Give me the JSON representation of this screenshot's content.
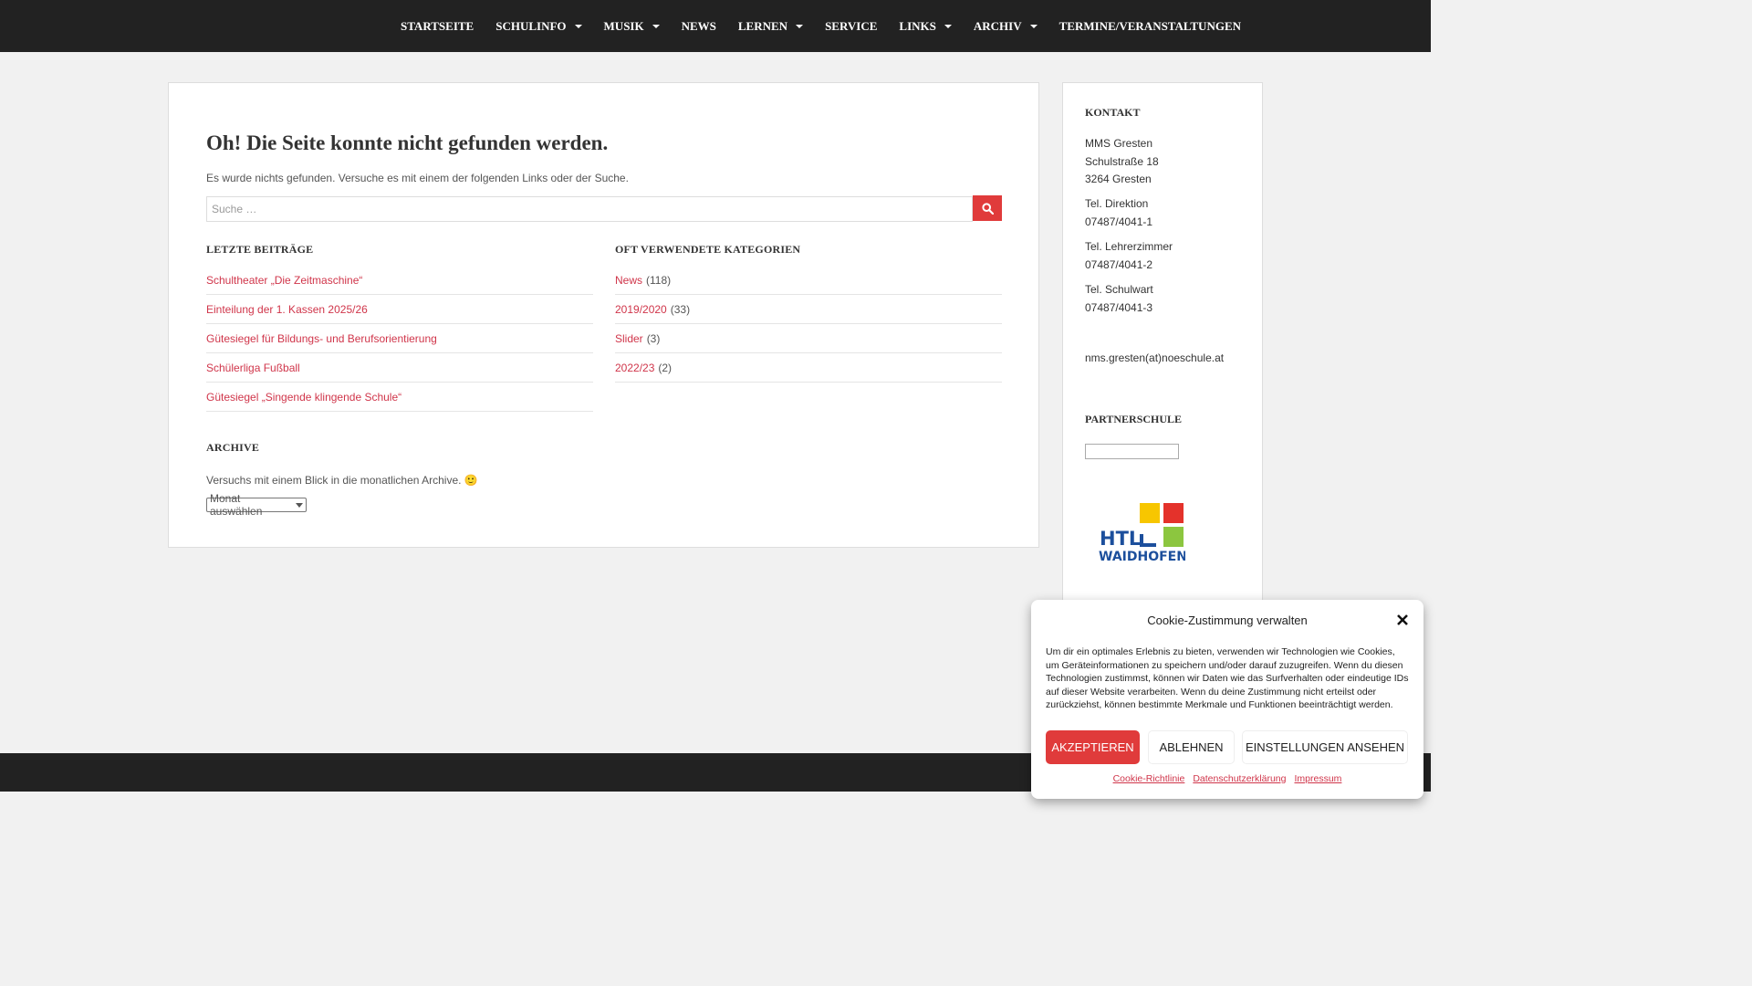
{
  "nav": {
    "items": [
      {
        "label": "STARTSEITE",
        "has_dropdown": false
      },
      {
        "label": "SCHULINFO",
        "has_dropdown": true
      },
      {
        "label": "MUSIK",
        "has_dropdown": true
      },
      {
        "label": "NEWS",
        "has_dropdown": false
      },
      {
        "label": "LERNEN",
        "has_dropdown": true
      },
      {
        "label": "SERVICE",
        "has_dropdown": false
      },
      {
        "label": "LINKS",
        "has_dropdown": true
      },
      {
        "label": "ARCHIV",
        "has_dropdown": true
      },
      {
        "label": "TERMINE/VERANSTALTUNGEN",
        "has_dropdown": false
      }
    ]
  },
  "main": {
    "title": "Oh! Die Seite konnte nicht gefunden werden.",
    "intro": "Es wurde nichts gefunden. Versuche es mit einem der folgenden Links oder der Suche.",
    "search": {
      "placeholder": "Suche …",
      "button_icon": "search-icon"
    },
    "recent_posts": {
      "title": "LETZTE BEITRÄGE",
      "items": [
        "Schultheater „Die Zeitmaschine“",
        "Einteilung der 1. Kassen 2025/26",
        "Gütesiegel für Bildungs- und Berufsorientierung",
        "Schülerliga Fußball",
        "Gütesiegel „Singende klingende Schule“"
      ]
    },
    "categories": {
      "title": "OFT VERWENDETE KATEGORIEN",
      "items": [
        {
          "name": "News",
          "count": "(118)"
        },
        {
          "name": "2019/2020",
          "count": "(33)"
        },
        {
          "name": "Slider",
          "count": "(3)"
        },
        {
          "name": "2022/23",
          "count": "(2)"
        }
      ]
    },
    "archive": {
      "title": "ARCHIVE",
      "text": "Versuchs mit einem Blick in die monatlichen Archive. 🙂",
      "select_value": "Monat auswählen"
    }
  },
  "sidebar": {
    "contact_title": "KONTAKT",
    "address": [
      "MMS Gresten",
      "Schulstraße 18",
      "3264 Gresten"
    ],
    "phones": [
      {
        "label": "Tel. Direktion",
        "number": "07487/4041-1"
      },
      {
        "label": "Tel. Lehrerzimmer",
        "number": "07487/4041-2"
      },
      {
        "label": "Tel. Schulwart",
        "number": "07487/4041-3"
      }
    ],
    "email": "nms.gresten(at)noeschule.at",
    "partner_title": "PARTNERSCHULE",
    "htl_logo": {
      "line1": "HTL",
      "line2": "WAIDHOFEN"
    }
  },
  "cookie": {
    "title": "Cookie-Zustimmung verwalten",
    "text": "Um dir ein optimales Erlebnis zu bieten, verwenden wir Technologien wie Cookies, um Geräteinformationen zu speichern und/oder darauf zuzugreifen. Wenn du diesen Technologien zustimmst, können wir Daten wie das Surfverhalten oder eindeutige IDs auf dieser Website verarbeiten. Wenn du deine Zustimmung nicht erteilst oder zurückziehst, können bestimmte Merkmale und Funktionen beeinträchtigt werden.",
    "accept_label": "AKZEPTIEREN",
    "deny_label": "ABLEHNEN",
    "prefs_label": "EINSTELLUNGEN ANSEHEN",
    "links": [
      "Cookie-Richtlinie",
      "Datenschutzerklärung",
      "Impressum"
    ]
  },
  "colors": {
    "accent": "#e03b3b",
    "link": "#d0354a",
    "nav_bg": "#222222"
  }
}
